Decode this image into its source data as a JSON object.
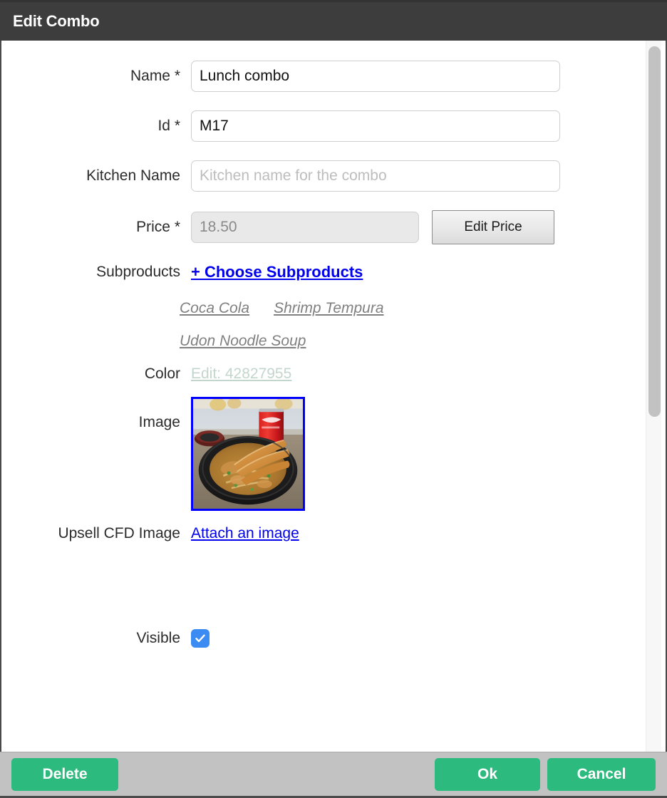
{
  "window": {
    "title": "Edit Combo"
  },
  "form": {
    "name": {
      "label": "Name *",
      "value": "Lunch combo",
      "placeholder": ""
    },
    "id": {
      "label": "Id *",
      "value": "M17",
      "placeholder": ""
    },
    "kitchen_name": {
      "label": "Kitchen Name",
      "value": "",
      "placeholder": "Kitchen name for the combo"
    },
    "price": {
      "label": "Price *",
      "value": "18.50",
      "placeholder": "",
      "edit_button": "Edit Price"
    },
    "subproducts": {
      "label": "Subproducts",
      "choose_link": "+ Choose Subproducts",
      "items": [
        "Coca Cola",
        "Shrimp Tempura",
        "Udon Noodle Soup"
      ]
    },
    "color": {
      "label": "Color",
      "link": "Edit: 42827955",
      "value": "42827955",
      "link_color": "#c3d6cd"
    },
    "image": {
      "label": "Image",
      "border_color": "#0000ff",
      "alt": "curry udon with shrimp tempura and a cola can"
    },
    "upsell_cfd_image": {
      "label": "Upsell CFD Image",
      "link": "Attach an image"
    },
    "visible": {
      "label": "Visible",
      "checked": true,
      "accent_color": "#3b8bf2"
    }
  },
  "footer": {
    "delete_label": "Delete",
    "ok_label": "Ok",
    "cancel_label": "Cancel",
    "button_color": "#2cba7e",
    "bar_color": "#c2c2c2"
  }
}
